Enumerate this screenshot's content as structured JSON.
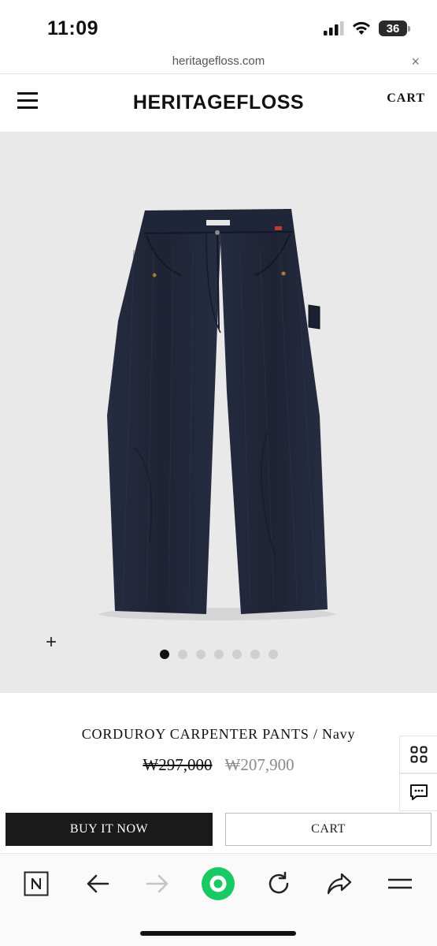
{
  "status": {
    "time": "11:09",
    "battery": "36"
  },
  "browser": {
    "url": "heritagefloss.com",
    "close_symbol": "×"
  },
  "header": {
    "logo": "HERITAGEFLOSS",
    "cart_label": "CART"
  },
  "gallery": {
    "zoom_symbol": "+",
    "dot_count": 7,
    "active_index": 0
  },
  "product": {
    "title": "CORDUROY CARPENTER PANTS / Navy",
    "price_original": "₩297,000",
    "price_sale": "₩207,900"
  },
  "actions": {
    "buy_now_label": "BUY IT NOW",
    "cart_label": "CART"
  },
  "colors": {
    "accent_green": "#18c964",
    "image_bg": "#e9e9ea",
    "pants_navy": "#1f2536"
  },
  "toolbar_icons": [
    "naver-n-icon",
    "back-arrow-icon",
    "forward-arrow-icon",
    "green-dot-icon",
    "refresh-icon",
    "share-icon",
    "menu-icon"
  ]
}
